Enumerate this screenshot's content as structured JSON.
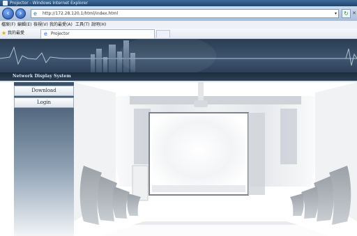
{
  "window": {
    "title": "Projector - Windows Internet Explorer"
  },
  "address_bar": {
    "url": "http://172.28.120.1/html/index.html"
  },
  "menu": [
    "檔案(F)",
    "編輯(E)",
    "檢視(V)",
    "我的最愛(A)",
    "工具(T)",
    "說明(H)"
  ],
  "favorites": {
    "label": "我的最愛"
  },
  "tab": {
    "title": "Projector"
  },
  "header": {
    "system_title": "Network Display System"
  },
  "sidebar": {
    "items": [
      {
        "label": "Download"
      },
      {
        "label": "Login"
      }
    ]
  },
  "colors": {
    "banner": "#3e5670",
    "sidebar_top": "#3a5068",
    "accent": "#2d6fcc"
  }
}
